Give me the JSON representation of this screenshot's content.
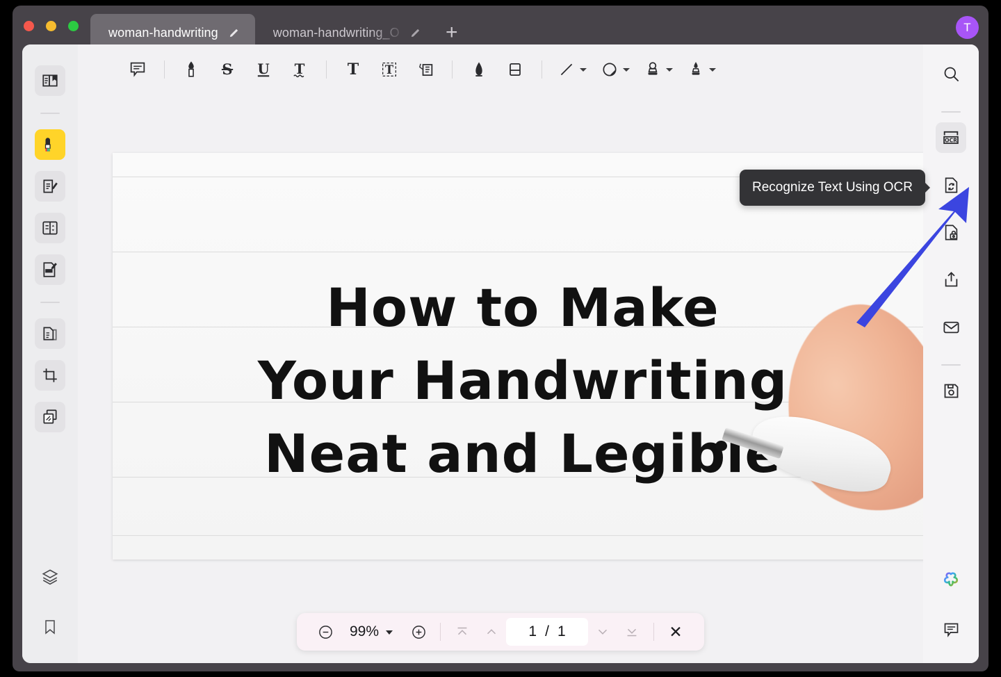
{
  "window": {
    "traffic_lights": [
      "close",
      "minimize",
      "maximize"
    ],
    "avatar_initial": "T",
    "accent_colors": {
      "tab_active_bg": "#6f6b71",
      "titlebar_bg": "#474349",
      "avatar_bg": "#a855f7",
      "highlight_tool": "#ffd429",
      "arrow_blue": "#3b45e0",
      "tooltip_bg": "#333336",
      "pager_bg": "#faf1f6"
    }
  },
  "tabs": {
    "items": [
      {
        "label": "woman-handwriting",
        "active": true,
        "edit_icon": "pencil-icon"
      },
      {
        "label": "woman-handwriting_O",
        "active": false,
        "edit_icon": "pencil-icon"
      }
    ],
    "new_tab_label": "+"
  },
  "toolbar": {
    "items": [
      {
        "name": "comment-note-icon",
        "label": "Note"
      },
      {
        "name": "highlight-icon",
        "label": "Highlight"
      },
      {
        "name": "strikethrough-icon",
        "label": "S"
      },
      {
        "name": "underline-icon",
        "label": "U"
      },
      {
        "name": "squiggly-underline-icon",
        "label": "T"
      },
      {
        "name": "text-icon",
        "label": "T"
      },
      {
        "name": "text-box-icon",
        "label": "Text Box"
      },
      {
        "name": "callout-icon",
        "label": "Callout"
      },
      {
        "name": "pencil-draw-icon",
        "label": "Pencil"
      },
      {
        "name": "eraser-icon",
        "label": "Eraser"
      },
      {
        "name": "line-shape-icon",
        "label": "Line"
      },
      {
        "name": "shape-icon",
        "label": "Shape"
      },
      {
        "name": "stamp-icon",
        "label": "Stamp"
      },
      {
        "name": "signature-icon",
        "label": "Signature"
      }
    ]
  },
  "sidebar_left": {
    "items": [
      {
        "name": "reader-view-icon",
        "active": false
      },
      {
        "name": "highlighter-markup-icon",
        "active": true
      },
      {
        "name": "edit-annotate-icon",
        "active": false
      },
      {
        "name": "form-fields-icon",
        "active": false
      },
      {
        "name": "redact-icon",
        "active": false
      },
      {
        "name": "organize-pages-icon",
        "active": false
      },
      {
        "name": "crop-page-icon",
        "active": false
      },
      {
        "name": "compare-documents-icon",
        "active": false
      },
      {
        "name": "layers-icon",
        "active": false
      },
      {
        "name": "bookmark-icon",
        "active": false
      }
    ]
  },
  "sidebar_right": {
    "items": [
      {
        "name": "search-icon",
        "hovered": false
      },
      {
        "name": "ocr-icon",
        "hovered": true,
        "label": "OCR"
      },
      {
        "name": "convert-icon",
        "hovered": false
      },
      {
        "name": "protect-lock-icon",
        "hovered": false
      },
      {
        "name": "share-icon",
        "hovered": false
      },
      {
        "name": "mail-icon",
        "hovered": false
      },
      {
        "name": "save-icon",
        "hovered": false
      },
      {
        "name": "ai-assistant-icon",
        "hovered": false
      },
      {
        "name": "comments-panel-icon",
        "hovered": false
      }
    ]
  },
  "tooltip": {
    "text": "Recognize Text Using OCR",
    "target": "ocr-icon"
  },
  "document": {
    "lines": [
      "How to Make",
      "Your Handwriting",
      "Neat and Legible"
    ],
    "description": "Handwritten title on lined paper with a white pen and finger at right"
  },
  "pager": {
    "zoom_out_label": "−",
    "zoom_level": "99%",
    "zoom_in_label": "+",
    "current_page": "1",
    "separator": "/",
    "total_pages": "1",
    "close_label": "✕"
  }
}
